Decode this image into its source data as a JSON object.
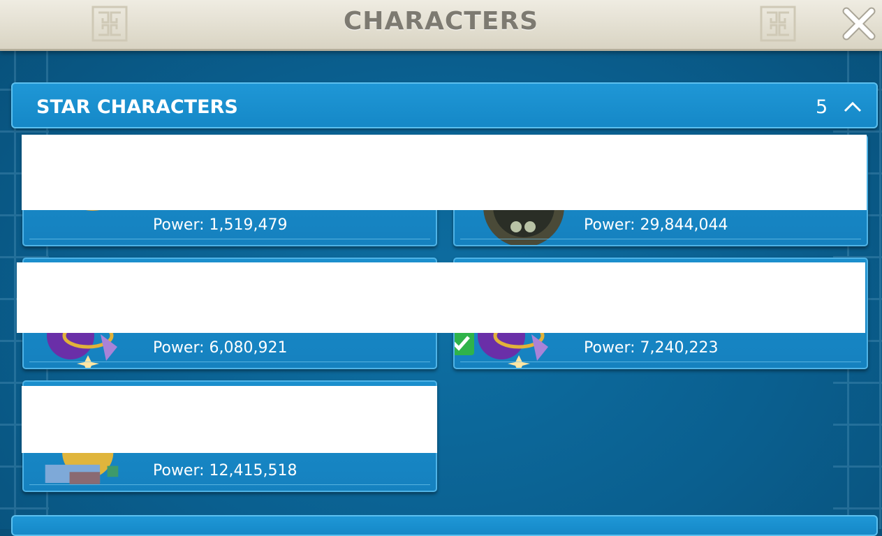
{
  "window": {
    "title": "CHARACTERS",
    "close_icon": "close-x-icon"
  },
  "section": {
    "label": "STAR CHARACTERS",
    "count": "5",
    "toggle_icon": "chevron-up-icon"
  },
  "characters": [
    {
      "power": "Power: 1,519,479",
      "portrait": "portrait-gold-ring-icon"
    },
    {
      "power": "Power: 29,844,044",
      "portrait": "portrait-bronze-frame-icon"
    },
    {
      "power": "Power: 6,080,921",
      "portrait": "portrait-purple-orb-icon"
    },
    {
      "power": "Power: 7,240,223",
      "portrait": "portrait-purple-orb-icon",
      "selected": true
    },
    {
      "power": "Power: 12,415,518",
      "portrait": "portrait-castle-gold-icon"
    }
  ],
  "colors": {
    "background": "#0a5f8f",
    "header": "#1f97d6",
    "card": "#1b8fcd",
    "titlebar": "#e8e4d8",
    "title_text": "#7d7a71",
    "check": "#2fb34a"
  }
}
